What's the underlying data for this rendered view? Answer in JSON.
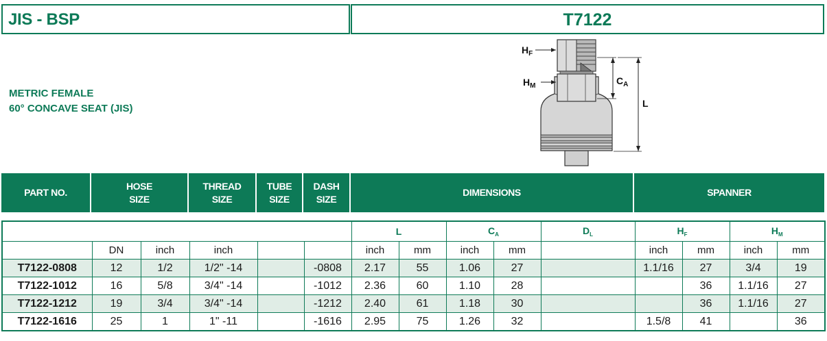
{
  "header": {
    "series": "JIS - BSP",
    "part": "T7122"
  },
  "description": {
    "line1": "METRIC FEMALE",
    "line2": "60° CONCAVE SEAT (JIS)"
  },
  "diagram": {
    "hf_label": "H",
    "hf_sub": "F",
    "hm_label": "H",
    "hm_sub": "M",
    "ca_label": "C",
    "ca_sub": "A",
    "l_label": "L"
  },
  "table_header": {
    "part_no": "PART NO.",
    "hose_size_1": "HOSE",
    "hose_size_2": "SIZE",
    "thread_size_1": "THREAD",
    "thread_size_2": "SIZE",
    "tube_size_1": "TUBE",
    "tube_size_2": "SIZE",
    "dash_size_1": "DASH",
    "dash_size_2": "SIZE",
    "dimensions": "DIMENSIONS",
    "spanner": "SPANNER"
  },
  "groups": {
    "l": "L",
    "ca": "C",
    "ca_sub": "A",
    "dl": "D",
    "dl_sub": "L",
    "hf": "H",
    "hf_sub": "F",
    "hm": "H",
    "hm_sub": "M"
  },
  "units": {
    "dn": "DN",
    "hose_inch": "inch",
    "thread_inch": "inch",
    "l_inch": "inch",
    "l_mm": "mm",
    "ca_inch": "inch",
    "ca_mm": "mm",
    "hf_inch": "inch",
    "hf_mm": "mm",
    "hm_inch": "inch",
    "hm_mm": "mm"
  },
  "rows": [
    {
      "part": "T7122-0808",
      "dn": "12",
      "hose_inch": "1/2",
      "thread": "1/2\" -14",
      "tube": "",
      "dash": "-0808",
      "l_in": "2.17",
      "l_mm": "55",
      "ca_in": "1.06",
      "ca_mm": "27",
      "dl": "",
      "hf_in": "1.1/16",
      "hf_mm": "27",
      "hm_in": "3/4",
      "hm_mm": "19"
    },
    {
      "part": "T7122-1012",
      "dn": "16",
      "hose_inch": "5/8",
      "thread": "3/4\" -14",
      "tube": "",
      "dash": "-1012",
      "l_in": "2.36",
      "l_mm": "60",
      "ca_in": "1.10",
      "ca_mm": "28",
      "dl": "",
      "hf_in": "",
      "hf_mm": "36",
      "hm_in": "1.1/16",
      "hm_mm": "27"
    },
    {
      "part": "T7122-1212",
      "dn": "19",
      "hose_inch": "3/4",
      "thread": "3/4\" -14",
      "tube": "",
      "dash": "-1212",
      "l_in": "2.40",
      "l_mm": "61",
      "ca_in": "1.18",
      "ca_mm": "30",
      "dl": "",
      "hf_in": "",
      "hf_mm": "36",
      "hm_in": "1.1/16",
      "hm_mm": "27"
    },
    {
      "part": "T7122-1616",
      "dn": "25",
      "hose_inch": "1",
      "thread": "1\" -11",
      "tube": "",
      "dash": "-1616",
      "l_in": "2.95",
      "l_mm": "75",
      "ca_in": "1.26",
      "ca_mm": "32",
      "dl": "",
      "hf_in": "1.5/8",
      "hf_mm": "41",
      "hm_in": "",
      "hm_mm": "36"
    }
  ],
  "colors": {
    "accent": "#0d7a57",
    "row_shade": "#e0ede6"
  }
}
